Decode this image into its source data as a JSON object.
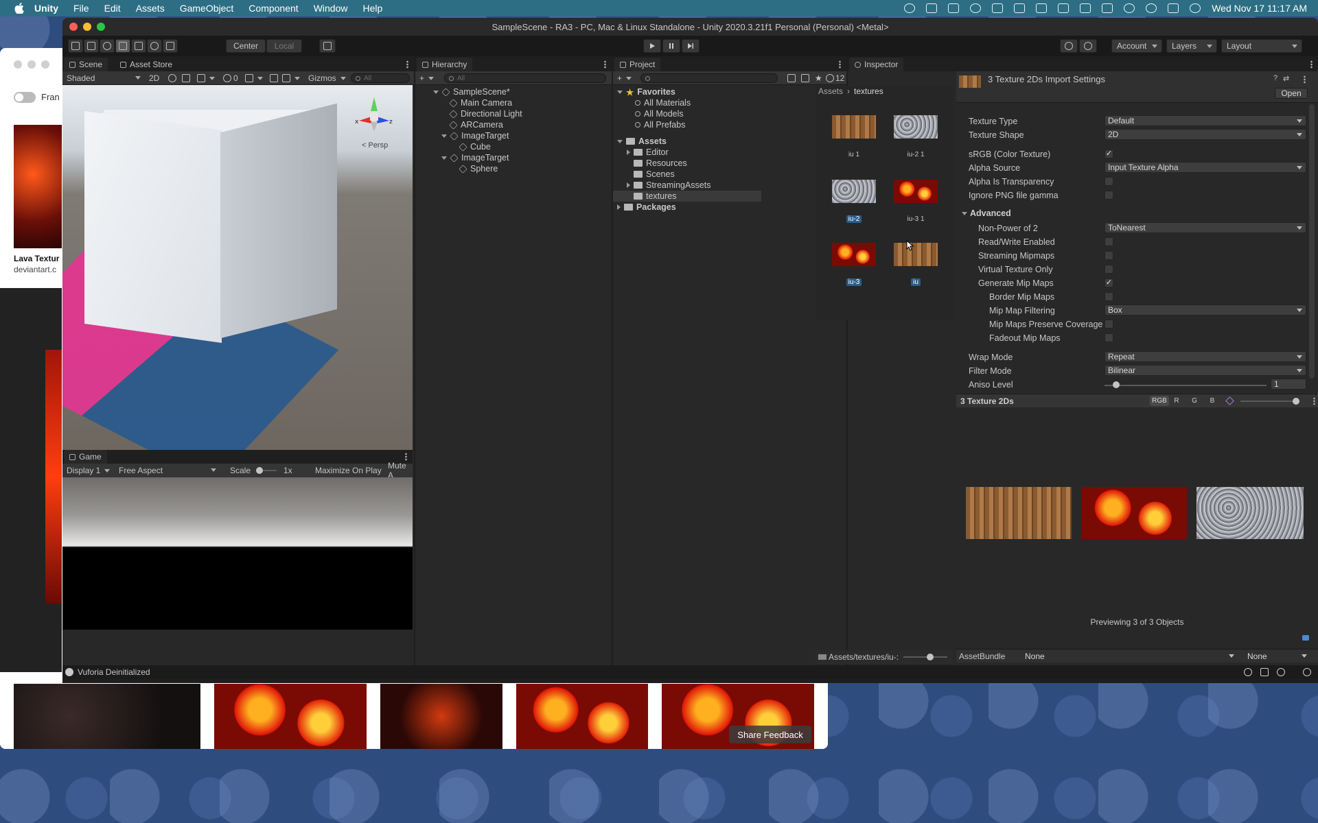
{
  "menubar": {
    "app": "Unity",
    "items": [
      "File",
      "Edit",
      "Assets",
      "GameObject",
      "Component",
      "Window",
      "Help"
    ],
    "clock": "Wed Nov 17  11:17 AM"
  },
  "browser": {
    "toggle_label": "Fran",
    "image_caption": "Lava Textur",
    "image_source": "deviantart.c",
    "share_feedback": "Share Feedback"
  },
  "window": {
    "title": "SampleScene - RA3 - PC, Mac & Linux Standalone - Unity 2020.3.21f1 Personal (Personal) <Metal>"
  },
  "toolbar": {
    "pivot_label": "Center",
    "space_label": "Local",
    "account_label": "Account",
    "layers_label": "Layers",
    "layout_label": "Layout"
  },
  "scene": {
    "tabs": [
      "Scene",
      "Asset Store"
    ],
    "shading": "Shaded",
    "mode_2d": "2D",
    "hidden_count": "0",
    "gizmos": "Gizmos",
    "search_placeholder": "All",
    "persp_label": "< Persp",
    "gizmo_axes": {
      "x": "x",
      "z": "z"
    }
  },
  "game": {
    "tab": "Game",
    "display": "Display 1",
    "aspect": "Free Aspect",
    "scale_label": "Scale",
    "scale_value": "1x",
    "maximize": "Maximize On Play",
    "mute": "Mute A"
  },
  "hierarchy": {
    "tab": "Hierarchy",
    "search_placeholder": "All",
    "scene_name": "SampleScene*",
    "items": [
      {
        "label": "Main Camera",
        "indent": 1
      },
      {
        "label": "Directional Light",
        "indent": 1
      },
      {
        "label": "ARCamera",
        "indent": 1
      },
      {
        "label": "ImageTarget",
        "indent": 1
      },
      {
        "label": "Cube",
        "indent": 2
      },
      {
        "label": "ImageTarget",
        "indent": 1
      },
      {
        "label": "Sphere",
        "indent": 2
      }
    ]
  },
  "project": {
    "tab": "Project",
    "hidden_count": "12",
    "favorites_label": "Favorites",
    "favorites": [
      "All Materials",
      "All Models",
      "All Prefabs"
    ],
    "assets_label": "Assets",
    "folders": [
      "Editor",
      "Resources",
      "Scenes",
      "StreamingAssets",
      "textures"
    ],
    "packages_label": "Packages",
    "breadcrumb": [
      "Assets",
      "textures"
    ],
    "assets": [
      {
        "label": "iu 1",
        "kind": "wood",
        "selected": false
      },
      {
        "label": "iu-2 1",
        "kind": "stone",
        "selected": false
      },
      {
        "label": "iu-2",
        "kind": "stone",
        "selected": true
      },
      {
        "label": "iu-3 1",
        "kind": "lava",
        "selected": false
      },
      {
        "label": "iu-3",
        "kind": "lava",
        "selected": true
      },
      {
        "label": "iu",
        "kind": "wood",
        "selected": true
      }
    ],
    "footer_path": "Assets/textures/iu-:"
  },
  "inspector": {
    "tab": "Inspector",
    "title": "3 Texture 2Ds Import Settings",
    "open_button": "Open",
    "texture_type_label": "Texture Type",
    "texture_type": "Default",
    "texture_shape_label": "Texture Shape",
    "texture_shape": "2D",
    "srgb_label": "sRGB (Color Texture)",
    "alpha_source_label": "Alpha Source",
    "alpha_source": "Input Texture Alpha",
    "alpha_transparency_label": "Alpha Is Transparency",
    "ignore_png_label": "Ignore PNG file gamma",
    "advanced_label": "Advanced",
    "npot_label": "Non-Power of 2",
    "npot": "ToNearest",
    "rw_label": "Read/Write Enabled",
    "streaming_label": "Streaming Mipmaps",
    "virtual_label": "Virtual Texture Only",
    "genmip_label": "Generate Mip Maps",
    "border_label": "Border Mip Maps",
    "mipfilter_label": "Mip Map Filtering",
    "mipfilter": "Box",
    "preserve_label": "Mip Maps Preserve Coverage",
    "fadeout_label": "Fadeout Mip Maps",
    "wrap_label": "Wrap Mode",
    "wrap": "Repeat",
    "filter_label": "Filter Mode",
    "filter": "Bilinear",
    "aniso_label": "Aniso Level",
    "aniso_value": "1",
    "preview_title": "3 Texture 2Ds",
    "channels": [
      "RGB",
      "R",
      "G",
      "B"
    ],
    "previewing": "Previewing 3 of 3 Objects",
    "assetbundle_label": "AssetBundle",
    "assetbundle": "None",
    "variant": "None"
  },
  "status": {
    "message": "Vuforia Deinitialized"
  },
  "colors": {
    "menubar": "#2d6e84",
    "selection": "#2c5d87",
    "panel": "#282828"
  }
}
